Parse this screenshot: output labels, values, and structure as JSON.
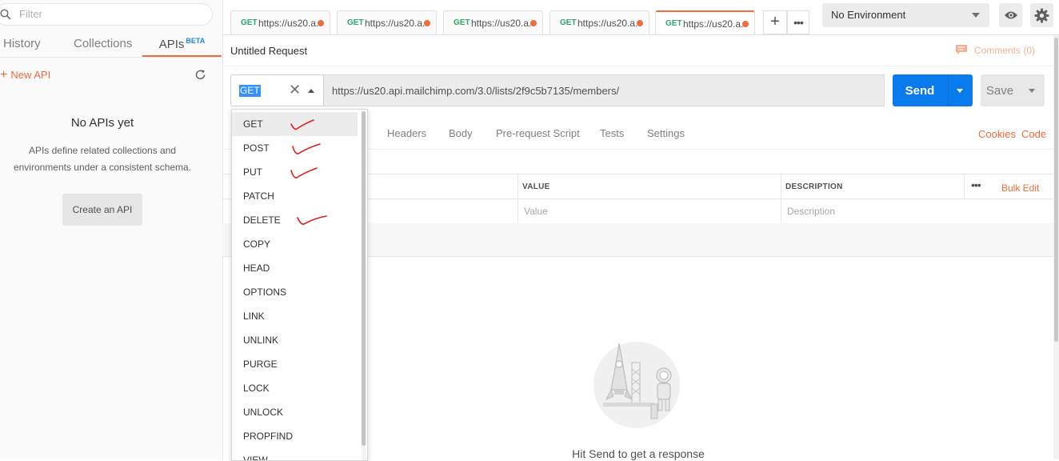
{
  "sidebar": {
    "filter_placeholder": "Filter",
    "tabs": [
      {
        "label": "History"
      },
      {
        "label": "Collections"
      },
      {
        "label": "APIs",
        "badge": "BETA"
      }
    ],
    "new_api_label": "New API",
    "empty_title": "No APIs yet",
    "empty_desc_line1": "APIs define related collections and",
    "empty_desc_line2": "environments under a consistent schema.",
    "create_api_label": "Create an API"
  },
  "request_tabs": [
    {
      "method": "GET",
      "url": "https://us20.a..."
    },
    {
      "method": "GET",
      "url": "https://us20.a..."
    },
    {
      "method": "GET",
      "url": "https://us20.a..."
    },
    {
      "method": "GET",
      "url": "https://us20.a..."
    },
    {
      "method": "GET",
      "url": "https://us20.a..."
    }
  ],
  "environment": {
    "selected": "No Environment"
  },
  "request": {
    "title": "Untitled Request",
    "comments_label": "Comments (0)",
    "method": "GET",
    "url": "https://us20.api.mailchimp.com/3.0/lists/2f9c5b7135/members/",
    "send_label": "Send",
    "save_label": "Save"
  },
  "subtabs": [
    "Headers",
    "Body",
    "Pre-request Script",
    "Tests",
    "Settings"
  ],
  "links": {
    "cookies": "Cookies",
    "code": "Code"
  },
  "params_table": {
    "columns": [
      "VALUE",
      "DESCRIPTION"
    ],
    "placeholders": {
      "value": "Value",
      "description": "Description"
    },
    "bulk_edit_label": "Bulk Edit"
  },
  "response": {
    "hint": "Hit Send to get a response"
  },
  "method_options": [
    {
      "label": "GET",
      "checked": true,
      "selected": true
    },
    {
      "label": "POST",
      "checked": true
    },
    {
      "label": "PUT",
      "checked": true
    },
    {
      "label": "PATCH"
    },
    {
      "label": "DELETE",
      "checked": true
    },
    {
      "label": "COPY"
    },
    {
      "label": "HEAD"
    },
    {
      "label": "OPTIONS"
    },
    {
      "label": "LINK"
    },
    {
      "label": "UNLINK"
    },
    {
      "label": "PURGE"
    },
    {
      "label": "LOCK"
    },
    {
      "label": "UNLOCK"
    },
    {
      "label": "PROPFIND"
    },
    {
      "label": "VIEW"
    }
  ],
  "colors": {
    "accent": "#f26b3a",
    "send": "#097bed",
    "get_method": "#2ba86a",
    "annotation": "#e0201c"
  }
}
